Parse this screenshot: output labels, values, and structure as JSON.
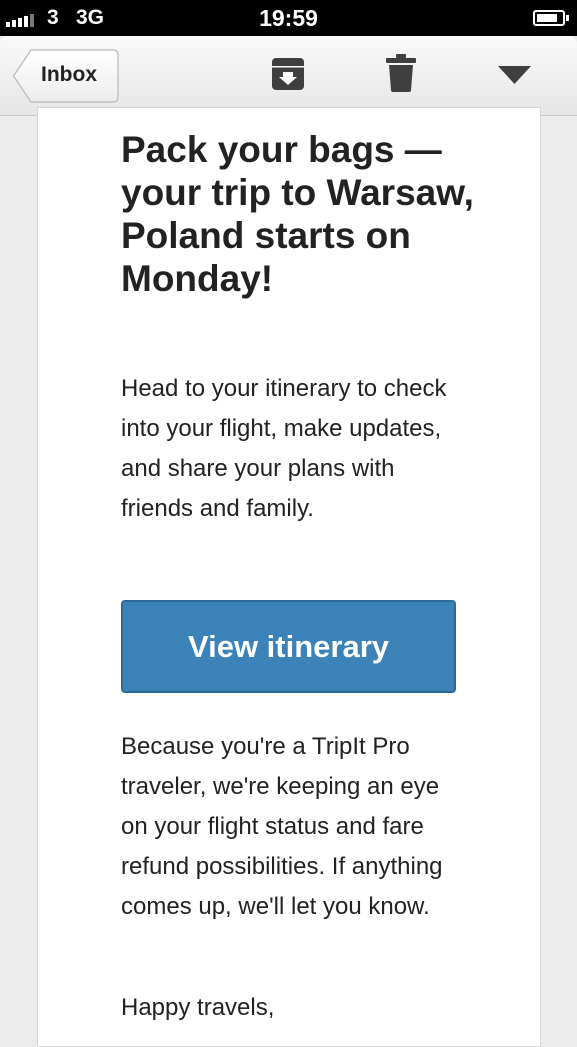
{
  "status_bar": {
    "carrier": "3",
    "network": "3G",
    "time": "19:59"
  },
  "toolbar": {
    "back_label": "Inbox",
    "icons": [
      "archive-icon",
      "trash-icon",
      "chevron-down-icon"
    ]
  },
  "email": {
    "headline": "Pack your bags — your trip to Warsaw, Poland starts on Monday!",
    "intro": "Head to your itinerary to check into your flight, make updates, and share your plans with friends and family.",
    "cta_label": "View itinerary",
    "pro_note": "Because you're a TripIt Pro traveler, we're keeping an eye on your flight status and fare refund possibilities. If anything comes up, we'll let you know.",
    "signoff": "Happy travels,"
  },
  "colors": {
    "cta_background": "#3b82b9",
    "text": "#222222"
  }
}
